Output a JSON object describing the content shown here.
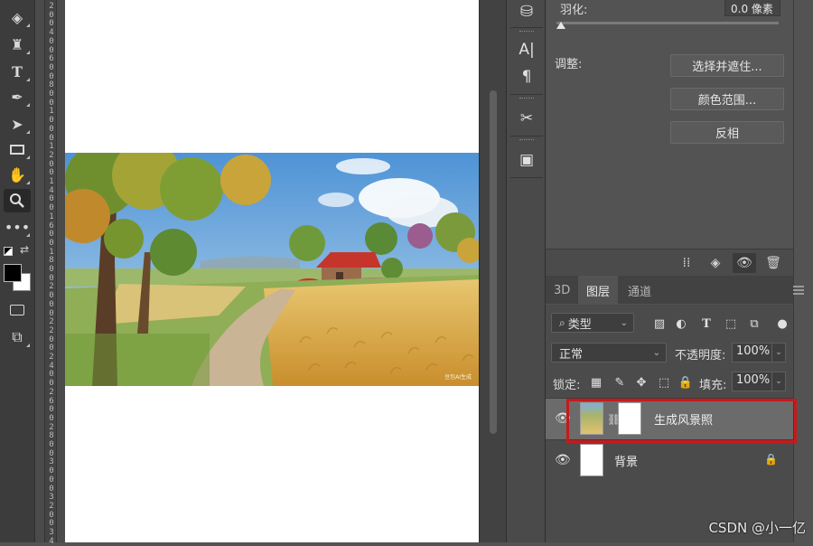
{
  "toolbar": {
    "tools": [
      {
        "name": "eraser-icon"
      },
      {
        "name": "paint-bucket-icon"
      },
      {
        "name": "type-tool-icon",
        "glyph": "T"
      },
      {
        "name": "pen-tool-icon"
      },
      {
        "name": "path-selection-icon"
      },
      {
        "name": "rectangle-tool-icon"
      },
      {
        "name": "hand-tool-icon"
      },
      {
        "name": "zoom-tool-icon",
        "active": true
      },
      {
        "name": "more-tools-icon"
      }
    ],
    "foreground_color": "#000000",
    "background_color": "#ffffff"
  },
  "ruler_digits": [
    "2",
    "0",
    "0",
    "4",
    "0",
    "0",
    "6",
    "0",
    "0",
    "8",
    "0",
    "0",
    "1",
    "0",
    "0",
    "0",
    "1",
    "2",
    "0",
    "0",
    "1",
    "4",
    "0",
    "0",
    "1",
    "6",
    "0",
    "0",
    "1",
    "8",
    "0",
    "0",
    "2",
    "0",
    "0",
    "0",
    "2",
    "2",
    "0",
    "0",
    "2",
    "4",
    "0",
    "0",
    "2",
    "6",
    "0",
    "0",
    "2",
    "8",
    "0",
    "0",
    "3",
    "0",
    "0",
    "0",
    "3",
    "2",
    "0",
    "0",
    "3",
    "4"
  ],
  "strip": {
    "icons": [
      "stamp-icon",
      "character-icon",
      "paragraph-icon",
      "tools-preset-icon",
      "layer-comps-icon"
    ],
    "character_glyph": "A|",
    "paragraph_glyph": "¶"
  },
  "properties": {
    "feather_label": "羽化:",
    "feather_value": "0.0 像素",
    "adjust_label": "调整:",
    "buttons": [
      "选择并遮住...",
      "颜色范围...",
      "反相"
    ]
  },
  "layers_panel": {
    "tabs": [
      {
        "label": "3D",
        "active": false
      },
      {
        "label": "图层",
        "active": true
      },
      {
        "label": "通道",
        "active": false
      }
    ],
    "filter_label": "类型",
    "blend_mode": "正常",
    "opacity_label": "不透明度:",
    "opacity_value": "100%",
    "lock_label": "锁定:",
    "fill_label": "填充:",
    "fill_value": "100%",
    "layers": [
      {
        "name": "生成风景照",
        "visible": true,
        "active": true,
        "has_mask": true
      },
      {
        "name": "背景",
        "visible": true,
        "active": false,
        "locked": true
      }
    ],
    "highlight_color": "#c8191c"
  },
  "canvas": {
    "watermark": "豆包AI生成"
  },
  "watermark_text": "CSDN @小一亿"
}
